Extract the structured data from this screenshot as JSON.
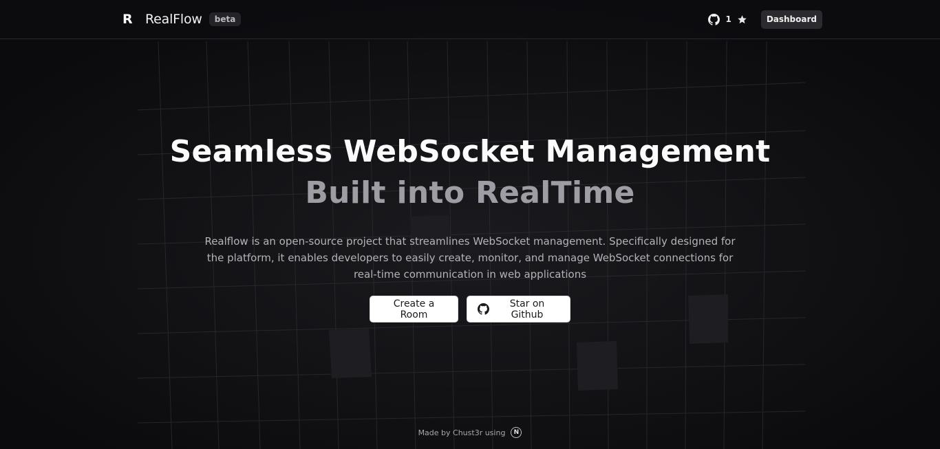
{
  "header": {
    "logo_glyph": "R",
    "brand_name": "RealFlow",
    "beta_label": "beta",
    "github_stars": "1",
    "dashboard_label": "Dashboard"
  },
  "hero": {
    "title_line1": "Seamless WebSocket Management",
    "title_line2": "Built into RealTime",
    "description": "Realflow is an open-source project that streamlines WebSocket management. Specifically designed for the platform, it enables developers to easily create, monitor, and manage WebSocket connections for real-time communication in web applications",
    "create_room_label": "Create a Room",
    "star_github_label": "Star on Github"
  },
  "footer": {
    "made_by_text": "Made by Chust3r using",
    "next_glyph": "N"
  },
  "colors": {
    "background": "#0c0c0e",
    "title_primary": "#fbfbfb",
    "title_secondary": "#9d9da3",
    "button_bg": "#ffffff",
    "dashboard_bg": "#2b2b2f"
  },
  "icons": [
    "github-icon",
    "star-icon",
    "nextjs-icon"
  ]
}
